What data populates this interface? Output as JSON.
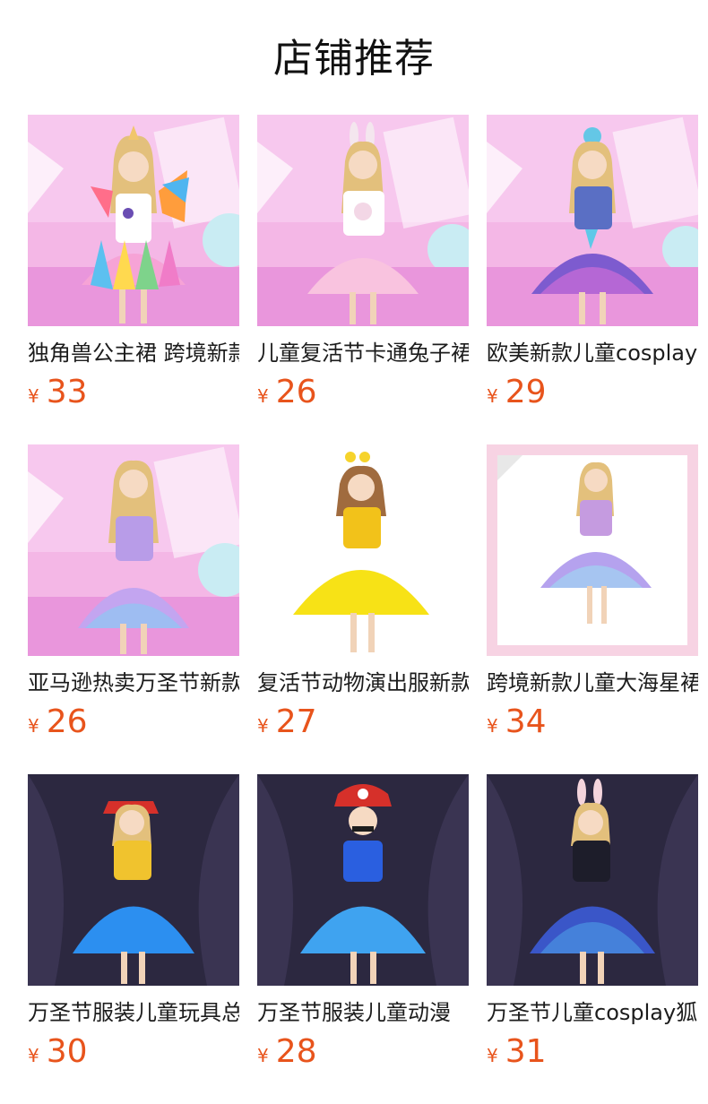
{
  "section_title": "店铺推荐",
  "colors": {
    "price": "#e8541c",
    "text": "#1c1c1c",
    "background": "#ffffff"
  },
  "products": [
    {
      "name": "独角兽公主裙 跨境新款",
      "currency": "¥",
      "price": "33",
      "image": "unicorn-rainbow-tutu-dress"
    },
    {
      "name": "儿童复活节卡通兔子裙",
      "currency": "¥",
      "price": "26",
      "image": "easter-bunny-pink-tutu-dress"
    },
    {
      "name": "欧美新款儿童cosplay",
      "currency": "¥",
      "price": "29",
      "image": "mermaid-purple-tutu-dress"
    },
    {
      "name": "亚马逊热卖万圣节新款",
      "currency": "¥",
      "price": "26",
      "image": "lavender-tutu-dress"
    },
    {
      "name": "复活节动物演出服新款",
      "currency": "¥",
      "price": "27",
      "image": "yellow-chick-tutu-dress"
    },
    {
      "name": "跨境新款儿童大海星裙",
      "currency": "¥",
      "price": "34",
      "image": "starfish-pastel-tutu-dress"
    },
    {
      "name": "万圣节服装儿童玩具总动员",
      "currency": "¥",
      "price": "30",
      "image": "cowgirl-blue-tutu-dress"
    },
    {
      "name": "万圣节服装儿童动漫",
      "currency": "¥",
      "price": "28",
      "image": "plumber-blue-tutu-dress"
    },
    {
      "name": "万圣节儿童cosplay狐",
      "currency": "¥",
      "price": "31",
      "image": "bunny-ears-navy-tutu-dress"
    }
  ]
}
